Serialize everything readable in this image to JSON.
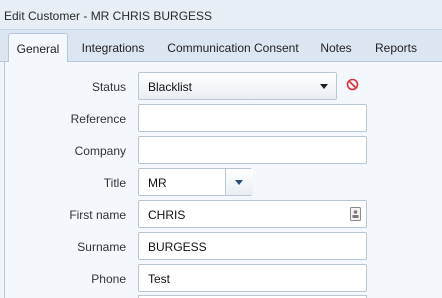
{
  "window": {
    "title": "Edit Customer - MR CHRIS BURGESS"
  },
  "tabs": [
    {
      "label": "General",
      "active": true
    },
    {
      "label": "Integrations",
      "active": false
    },
    {
      "label": "Communication Consent",
      "active": false
    },
    {
      "label": "Notes",
      "active": false
    },
    {
      "label": "Reports",
      "active": false
    }
  ],
  "form": {
    "status": {
      "label": "Status",
      "value": "Blacklist",
      "icon": "block-icon"
    },
    "reference": {
      "label": "Reference",
      "value": ""
    },
    "company": {
      "label": "Company",
      "value": ""
    },
    "title": {
      "label": "Title",
      "value": "MR"
    },
    "first_name": {
      "label": "First name",
      "value": "CHRIS",
      "icon": "contact-card-icon"
    },
    "surname": {
      "label": "Surname",
      "value": "BURGESS"
    },
    "phone": {
      "label": "Phone",
      "value": "Test"
    }
  },
  "colors": {
    "status_icon": "#d9303a",
    "tab_strip": "#dce6f2",
    "panel": "#f4f8fc"
  }
}
